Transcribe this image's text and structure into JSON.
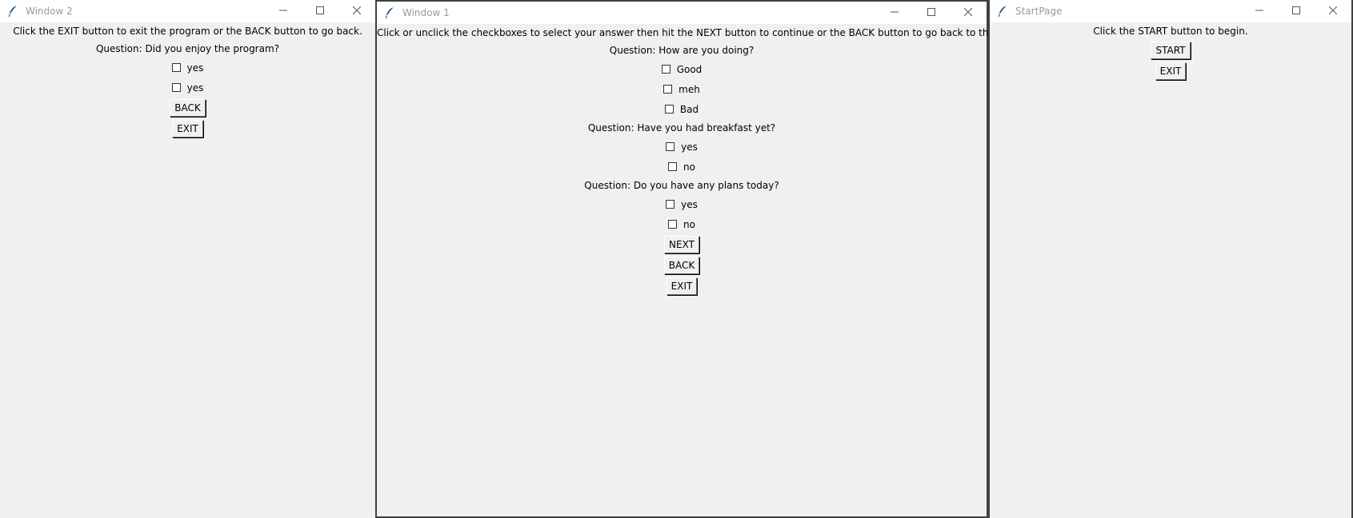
{
  "windows": {
    "window2": {
      "title": "Window 2",
      "instructions": "Click the EXIT button to exit the program or the BACK button to go back.",
      "question": "Question: Did you enjoy the program?",
      "options": [
        "yes",
        "yes"
      ],
      "back_label": "BACK",
      "exit_label": "EXIT"
    },
    "window1": {
      "title": "Window 1",
      "instructions": "Click or unclick the checkboxes to select your answer then hit the NEXT button to continue or the BACK button to go back to the previous page.",
      "questions": [
        {
          "text": "Question: How are you doing?",
          "options": [
            "Good",
            "meh",
            "Bad"
          ]
        },
        {
          "text": "Question: Have you had breakfast yet?",
          "options": [
            "yes",
            "no"
          ]
        },
        {
          "text": "Question: Do you have any plans today?",
          "options": [
            "yes",
            "no"
          ]
        }
      ],
      "next_label": "NEXT",
      "back_label": "BACK",
      "exit_label": "EXIT"
    },
    "startpage": {
      "title": "StartPage",
      "instructions": "Click the START button to begin.",
      "start_label": "START",
      "exit_label": "EXIT"
    }
  },
  "icons": {
    "app": "feather-icon",
    "minimize": "minimize-icon",
    "maximize": "maximize-icon",
    "close": "close-icon"
  },
  "colors": {
    "window_bg": "#f0f0f0",
    "titlebar_bg": "#ffffff",
    "title_text": "#9a9a9a"
  }
}
